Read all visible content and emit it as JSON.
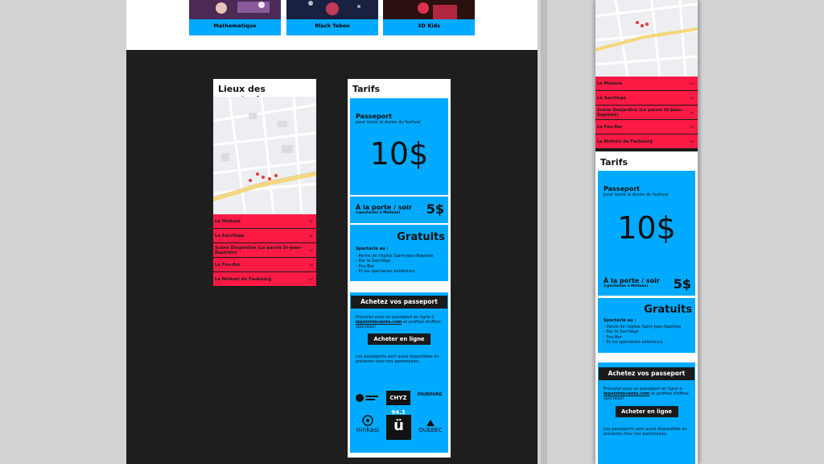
{
  "artists": [
    {
      "name": "Mathematique"
    },
    {
      "name": "Black Taboo"
    },
    {
      "name": "3D Kids"
    }
  ],
  "venues": {
    "title": "Lieux des spectacles",
    "items": [
      "La Méduse",
      "Le Sacrilège",
      "Scène Desjardins (Le parvis St-Jean-Baptiste)",
      "Le Fou-Bar",
      "La Ninkasi du Faubourg"
    ]
  },
  "tarifs": {
    "title": "Tarifs",
    "passport_title": "Passeport",
    "passport_sub": "pour toute la durée du festival",
    "passport_price": "10$",
    "door_title": "À la porte / soir",
    "door_sub": "(spectacles à Méduse)",
    "door_price": "5$",
    "free_title": "Gratuits",
    "free_intro": "Spectacle au :",
    "free_items": [
      "- Parvis de l'église Saint-Jean-Baptiste",
      "- Bar le Sacrilège",
      "- Fou-Bar",
      "- Et les spectacles extérieurs"
    ],
    "buy_title": "Achetez vos passeport",
    "buy_text_1": "Procurez-vous un passeport en ligne à",
    "buy_link": "lepointdevente.com",
    "buy_text_2": "et profitez d'offres spéciales!",
    "buy_button": "Acheter en ligne",
    "partners_text": "Les passeports sont aussi disponibles en prévente chez nos partenaires:",
    "partners": [
      "CHYZ 94.3",
      "FAUBOURG",
      "ninkasi",
      "ü",
      "QUÉBEC"
    ]
  },
  "colors": {
    "accent_blue": "#00aaff",
    "accent_red": "#ff1a45",
    "dark": "#1e1e1e"
  }
}
